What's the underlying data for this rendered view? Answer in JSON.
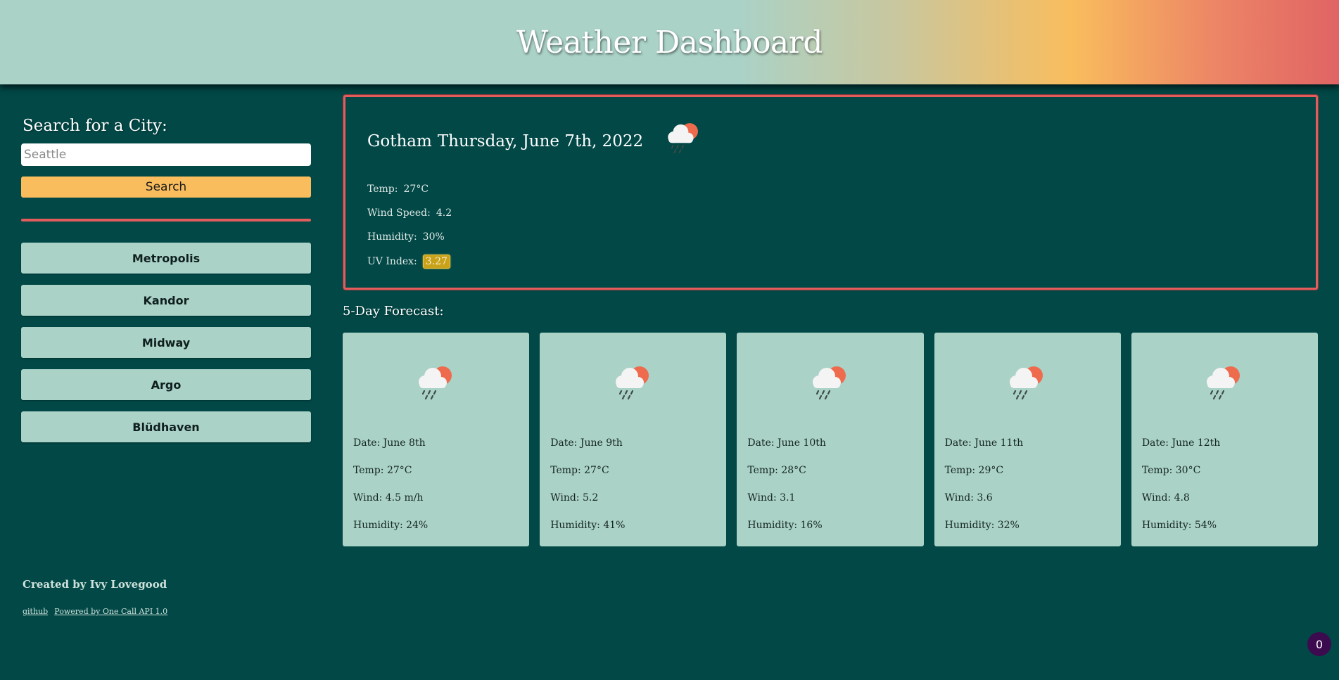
{
  "header": {
    "title": "Weather Dashboard"
  },
  "sidebar": {
    "heading": "Search for a City:",
    "search_placeholder": "Seattle",
    "search_button": "Search",
    "history": [
      {
        "label": "Metropolis"
      },
      {
        "label": "Kandor"
      },
      {
        "label": "Midway"
      },
      {
        "label": "Argo"
      },
      {
        "label": "Blüdhaven"
      }
    ]
  },
  "current": {
    "city": "Gotham",
    "date": "Thursday, June 7th, 2022",
    "icon": "rain-cloud-sun-icon",
    "temp_label": "Temp:",
    "temp": "27°C",
    "wind_label": "Wind Speed:",
    "wind": "4.2",
    "humidity_label": "Humidity:",
    "humidity": "30%",
    "uv_label": "UV Index:",
    "uv": "3.27"
  },
  "forecast": {
    "heading": "5-Day Forecast:",
    "days": [
      {
        "date": "Date: June 8th",
        "temp": "Temp: 27°C",
        "wind": "Wind: 4.5 m/h",
        "humidity": "Humidity: 24%"
      },
      {
        "date": "Date: June 9th",
        "temp": "Temp: 27°C",
        "wind": "Wind: 5.2",
        "humidity": "Humidity: 41%"
      },
      {
        "date": "Date: June 10th",
        "temp": "Temp: 28°C",
        "wind": "Wind: 3.1",
        "humidity": "Humidity: 16%"
      },
      {
        "date": "Date: June 11th",
        "temp": "Temp: 29°C",
        "wind": "Wind: 3.6",
        "humidity": "Humidity: 32%"
      },
      {
        "date": "Date: June 12th",
        "temp": "Temp: 30°C",
        "wind": "Wind: 4.8",
        "humidity": "Humidity: 54%"
      }
    ]
  },
  "footer": {
    "credit": "Created by Ivy Lovegood",
    "link_github": "github",
    "link_api": "Powered by One Call API 1.0"
  },
  "notification_count": "0",
  "colors": {
    "background": "#014846",
    "card": "#aad2c7",
    "accent_yellow": "#f9bd5d",
    "accent_red": "#e35d5d"
  }
}
